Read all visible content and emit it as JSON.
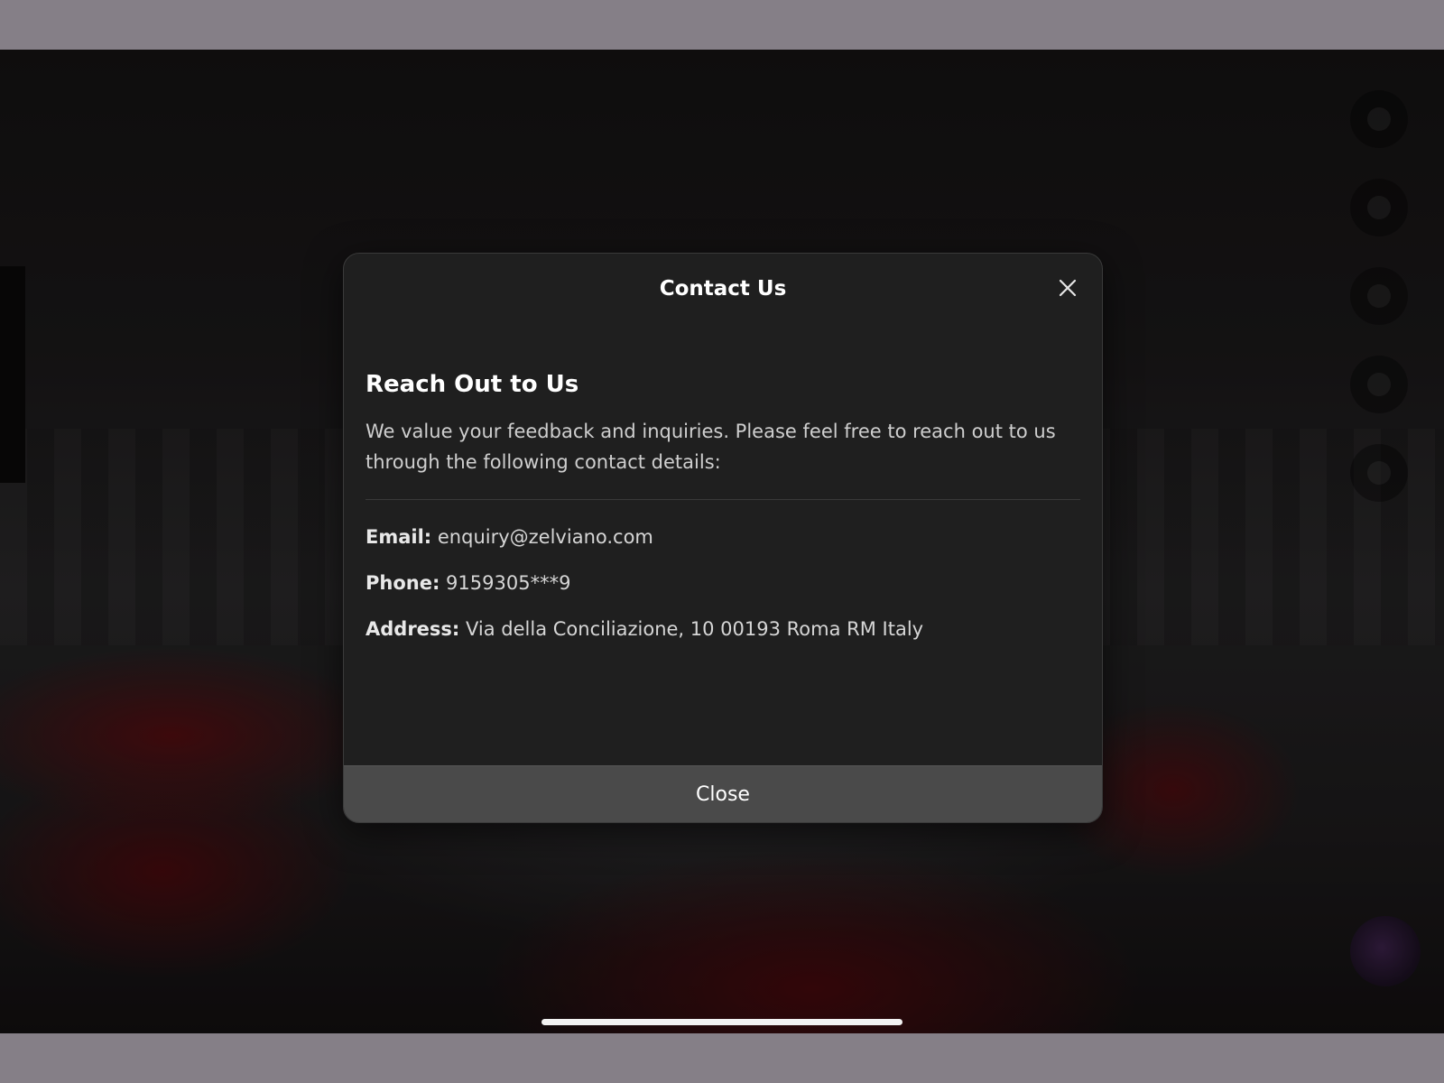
{
  "modal": {
    "title": "Contact Us",
    "close_icon": "close-icon",
    "heading": "Reach Out to Us",
    "description": "We value your feedback and inquiries. Please feel free to reach out to us through the following contact details:",
    "email_label": "Email:",
    "email_value": "enquiry@zelviano.com",
    "phone_label": "Phone:",
    "phone_value": "9159305***9",
    "address_label": "Address:",
    "address_value": "Via della Conciliazione, 10 00193 Roma RM Italy",
    "close_button_label": "Close"
  },
  "colors": {
    "modal_background": "#1f1f1f",
    "close_button_background": "#4a4a4a",
    "frame_background": "#857f87"
  }
}
